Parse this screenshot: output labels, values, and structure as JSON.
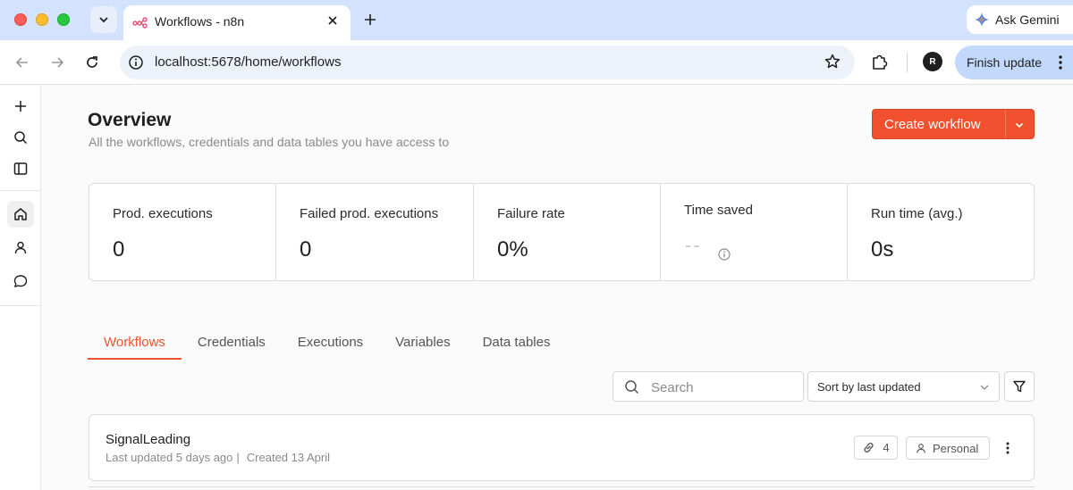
{
  "browser": {
    "tab_title": "Workflows - n8n",
    "url": "localhost:5678/home/workflows",
    "gemini_label": "Ask Gemini",
    "finish_update_label": "Finish update",
    "profile_initial": "R"
  },
  "page": {
    "title": "Overview",
    "subtitle": "All the workflows, credentials and data tables you have access to",
    "create_button_label": "Create workflow"
  },
  "stats": [
    {
      "label": "Prod. executions",
      "value": "0"
    },
    {
      "label": "Failed prod. executions",
      "value": "0"
    },
    {
      "label": "Failure rate",
      "value": "0%"
    },
    {
      "label": "Time saved",
      "value": "--"
    },
    {
      "label": "Run time (avg.)",
      "value": "0s"
    }
  ],
  "tabs": [
    {
      "label": "Workflows",
      "active": true
    },
    {
      "label": "Credentials",
      "active": false
    },
    {
      "label": "Executions",
      "active": false
    },
    {
      "label": "Variables",
      "active": false
    },
    {
      "label": "Data tables",
      "active": false
    }
  ],
  "search": {
    "placeholder": "Search",
    "value": ""
  },
  "sort": {
    "selected": "Sort by last updated"
  },
  "workflows": [
    {
      "name": "SignalLeading",
      "last_updated": "Last updated 5 days ago",
      "created": "Created 13 April",
      "link_count": "4",
      "owner": "Personal"
    }
  ],
  "colors": {
    "accent": "#f0502d",
    "tabstrip": "#d3e3fd",
    "active_tab_text": "#e8542f"
  }
}
